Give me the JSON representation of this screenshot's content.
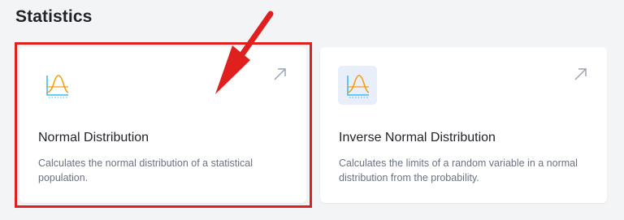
{
  "section": {
    "title": "Statistics"
  },
  "cards": [
    {
      "title": "Normal Distribution",
      "description": "Calculates the normal distribution of a statistical population.",
      "icon": "normal-curve-icon",
      "link_icon": "external-arrow-icon",
      "highlighted": true
    },
    {
      "title": "Inverse Normal Distribution",
      "description": "Calculates the limits of a random variable in a normal distribution from the probability.",
      "icon": "normal-curve-icon",
      "link_icon": "external-arrow-icon",
      "highlighted": false
    }
  ],
  "annotation": {
    "color": "#e01f1f",
    "type": "red-arrow-and-box"
  },
  "colors": {
    "icon_axis": "#38bdf8",
    "icon_curve": "#f59e0b",
    "link_icon": "#9ca3af"
  }
}
